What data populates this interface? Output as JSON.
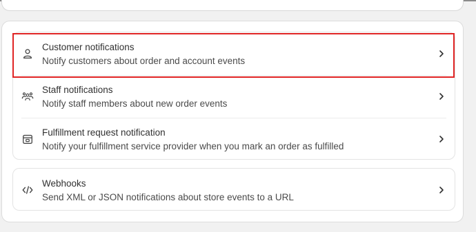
{
  "groups": [
    {
      "items": [
        {
          "title": "Customer notifications",
          "subtitle": "Notify customers about order and account events",
          "icon": "person-icon"
        },
        {
          "title": "Staff notifications",
          "subtitle": "Notify staff members about new order events",
          "icon": "team-icon"
        },
        {
          "title": "Fulfillment request notification",
          "subtitle": "Notify your fulfillment service provider when you mark an order as fulfilled",
          "icon": "fulfillment-icon"
        }
      ]
    },
    {
      "items": [
        {
          "title": "Webhooks",
          "subtitle": "Send XML or JSON notifications about store events to a URL",
          "icon": "code-icon"
        }
      ]
    }
  ],
  "highlight_color": "#e02424"
}
